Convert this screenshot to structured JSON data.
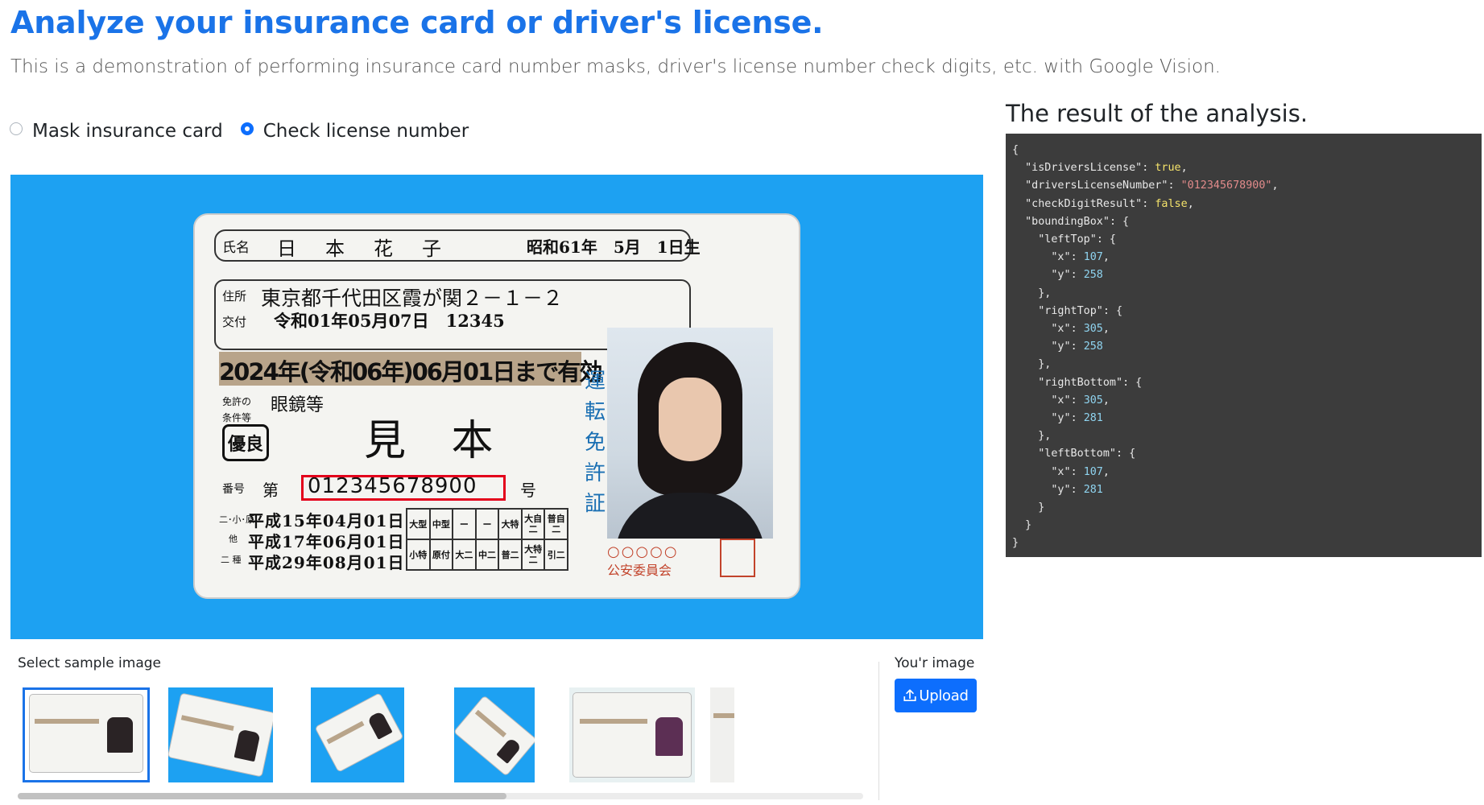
{
  "header": {
    "title": "Analyze your insurance card or driver's license.",
    "subtitle": "This is a demonstration of performing insurance card number masks, driver's license number check digits, etc. with Google Vision."
  },
  "mode": {
    "options": [
      {
        "label": "Mask insurance card",
        "checked": false
      },
      {
        "label": "Check license number",
        "checked": true
      }
    ]
  },
  "card": {
    "name_label": "氏名",
    "name": "日　本　花　子",
    "birth": "昭和61年　5月　1日生",
    "address_label": "住所",
    "address": "東京都千代田区霞が関２－１－２",
    "issue_label": "交付",
    "issue": "令和01年05月07日　12345",
    "validity": "2024年(令和06年)06月01日まで有効",
    "conditions_label": "免許の条件等",
    "conditions": "眼鏡等",
    "excellent": "優良",
    "sample": "見 本",
    "number_label": "番号",
    "number_prefix": "第",
    "number": "012345678900",
    "number_suffix": "号",
    "vertical_title": "運転免許証",
    "date1_label": "二･小･原",
    "date1": "平成15年04月01日",
    "date2_label": "他",
    "date2": "平成17年06月01日",
    "date3_label": "二 種",
    "date3": "平成29年08月01日",
    "types": [
      "大型",
      "中型",
      "ー",
      "ー",
      "大特",
      "大自二",
      "普自二",
      "小特",
      "原付",
      "大二",
      "中二",
      "普二",
      "大特二",
      "引二"
    ],
    "commission": "公安委員会",
    "commission_marks": "○○○○○"
  },
  "samples": {
    "label": "Select sample image",
    "selected_index": 0
  },
  "upload": {
    "label": "You'r image",
    "button": "Upload"
  },
  "result": {
    "title": "The result of the analysis.",
    "isDriversLicense": "true",
    "driversLicenseNumber": "\"012345678900\"",
    "checkDigitResult": "false",
    "leftTop": {
      "x": "107",
      "y": "258"
    },
    "rightTop": {
      "x": "305",
      "y": "258"
    },
    "rightBottom": {
      "x": "305",
      "y": "281"
    },
    "leftBottom": {
      "x": "107",
      "y": "281"
    }
  },
  "colors": {
    "title": "#1a73e8",
    "preview_bg": "#1da1f2",
    "code_bg": "#3c3c3c",
    "highlight": "#e3001b"
  }
}
